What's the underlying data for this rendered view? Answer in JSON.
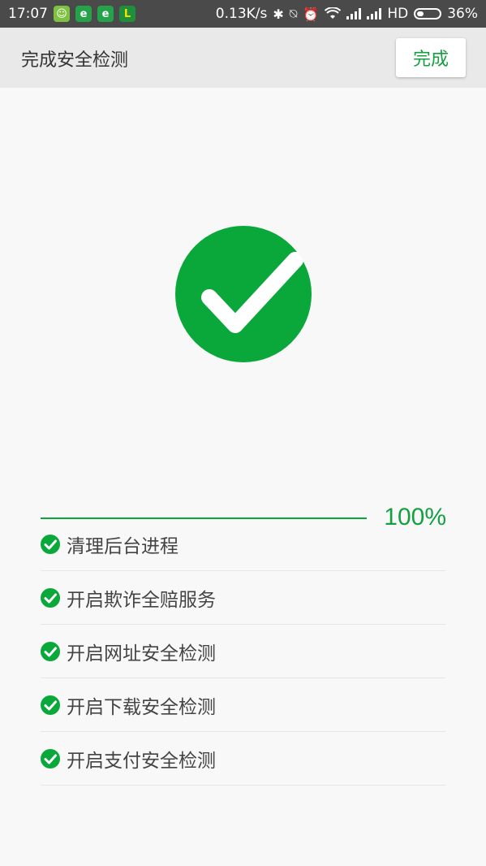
{
  "status_bar": {
    "time": "17:07",
    "network_speed": "0.13K/s",
    "network_type": "HD",
    "battery": "36%",
    "battery_level": 0.36,
    "icons": [
      "android-icon",
      "browser-e-icon",
      "browser-e-icon",
      "app-l-icon",
      "bluetooth-icon",
      "mute-icon",
      "alarm-icon",
      "wifi-icon",
      "signal-icon",
      "signal-icon",
      "battery-icon"
    ]
  },
  "header": {
    "title": "完成安全检测",
    "done_label": "完成"
  },
  "result": {
    "icon": "check-circle-icon",
    "progress_value": 1.0,
    "progress_label": "100%"
  },
  "checks": {
    "items": [
      {
        "label": "清理后台进程"
      },
      {
        "label": "开启欺诈全赔服务"
      },
      {
        "label": "开启网址安全检测"
      },
      {
        "label": "开启下载安全检测"
      },
      {
        "label": "开启支付安全检测"
      }
    ]
  },
  "colors": {
    "accent": "#0aa83b",
    "status_bar": "#4a4a4a",
    "app_bar": "#e9e9e9",
    "background": "#f8f8f8"
  }
}
